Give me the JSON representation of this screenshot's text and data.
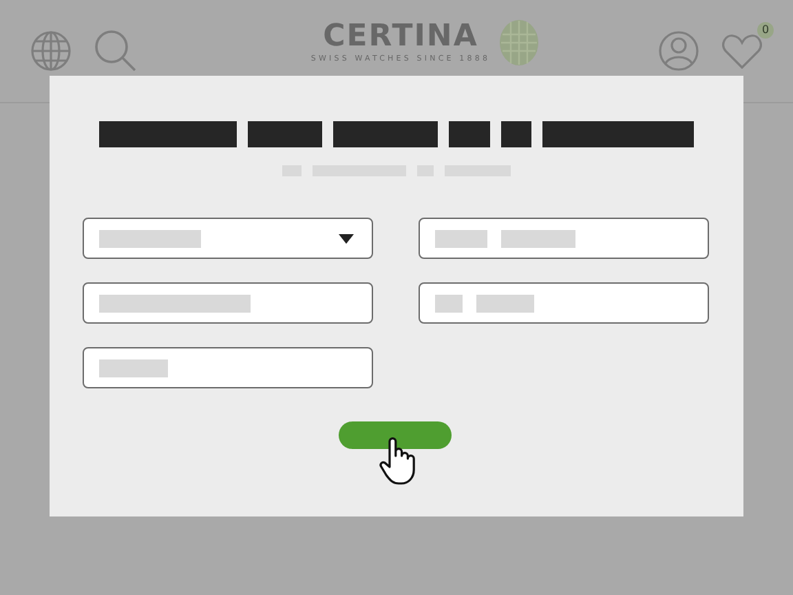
{
  "header": {
    "logo": "CERTINA",
    "tagline": "SWISS WATCHES SINCE 1888",
    "wishlist_count": "0"
  },
  "dialog": {
    "fields": [
      {
        "kind": "select"
      },
      {
        "kind": "text"
      },
      {
        "kind": "text"
      },
      {
        "kind": "text"
      },
      {
        "kind": "text"
      }
    ]
  }
}
